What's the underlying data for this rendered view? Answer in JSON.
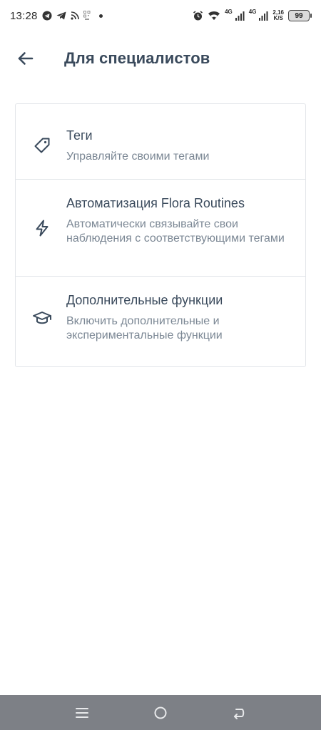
{
  "status_bar": {
    "time": "13:28",
    "left_icons": [
      "telegram-icon",
      "telegram-send-icon",
      "rss-icon",
      "qr-icon"
    ],
    "network_1": "4G",
    "network_2": "4G",
    "speed_value": "2,16",
    "speed_unit": "K/S",
    "battery": "99"
  },
  "app_bar": {
    "back_icon": "arrow-left-icon",
    "title": "Для специалистов"
  },
  "settings": [
    {
      "icon": "tag-icon",
      "title": "Теги",
      "subtitle": "Управляйте своими тегами"
    },
    {
      "icon": "lightning-icon",
      "title": "Автоматизация Flora Routines",
      "subtitle": "Автоматически связывайте свои наблюдения с соответствующими тегами"
    },
    {
      "icon": "graduation-cap-icon",
      "title": "Дополнительные функции",
      "subtitle": "Включить дополнительные и экспериментальные функции"
    }
  ],
  "nav_bar": {
    "buttons": [
      "menu-icon",
      "home-icon",
      "back-icon"
    ]
  },
  "colors": {
    "text_primary": "#3a4a5c",
    "text_secondary": "#7b8794",
    "divider": "#e2e5e9",
    "nav_bar": "#7d8086"
  }
}
